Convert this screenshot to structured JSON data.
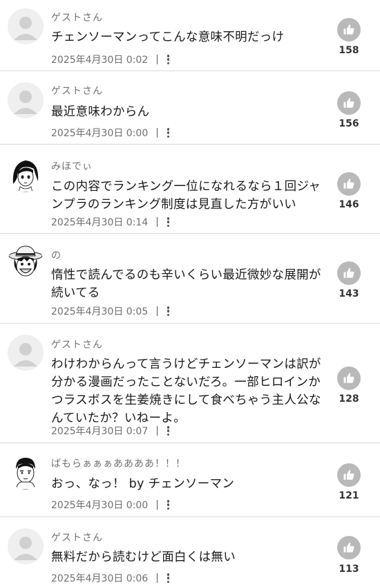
{
  "comments": [
    {
      "author": "ゲストさん",
      "avatar": "guest-avatar-icon",
      "text": "チェンソーマンってこんな意味不明だっけ",
      "timestamp": "2025年4月30日 0:02",
      "likes": "158"
    },
    {
      "author": "ゲストさん",
      "avatar": "guest-avatar-icon",
      "text": "最近意味わからん",
      "timestamp": "2025年4月30日 0:00",
      "likes": "156"
    },
    {
      "author": "みほでぃ",
      "avatar": "girl-manga-avatar-icon",
      "text": "この内容でランキング一位になれるなら１回ジャンプラのランキング制度は見直した方がいい",
      "timestamp": "2025年4月30日 0:14",
      "likes": "146"
    },
    {
      "author": "の",
      "avatar": "straw-hat-avatar-icon",
      "text": "惰性で読んでるのも辛いくらい最近微妙な展開が続いてる",
      "timestamp": "2025年4月30日 0:05",
      "likes": "143"
    },
    {
      "author": "ゲストさん",
      "avatar": "guest-avatar-icon",
      "text": "わけわからんって言うけどチェンソーマンは訳が分かる漫画だったことないだろ。一部ヒロインかつラスボスを生姜焼きにして食べちゃう主人公なんていたか？いねーよ。",
      "timestamp": "2025年4月30日 0:07",
      "likes": "128"
    },
    {
      "author": "ばもらぁぁぁああああ！！！",
      "avatar": "boy-manga-avatar-icon",
      "text": "おっ、なっ！ by チェンソーマン",
      "timestamp": "2025年4月30日 0:00",
      "likes": "121"
    },
    {
      "author": "ゲストさん",
      "avatar": "guest-avatar-icon",
      "text": "無料だから読むけど面白くは無い",
      "timestamp": "2025年4月30日 0:06",
      "likes": "113"
    }
  ],
  "colors": {
    "like_button": "#b9b9b9",
    "divider": "#d9d9d9",
    "secondary_text": "#6e6e6e"
  }
}
